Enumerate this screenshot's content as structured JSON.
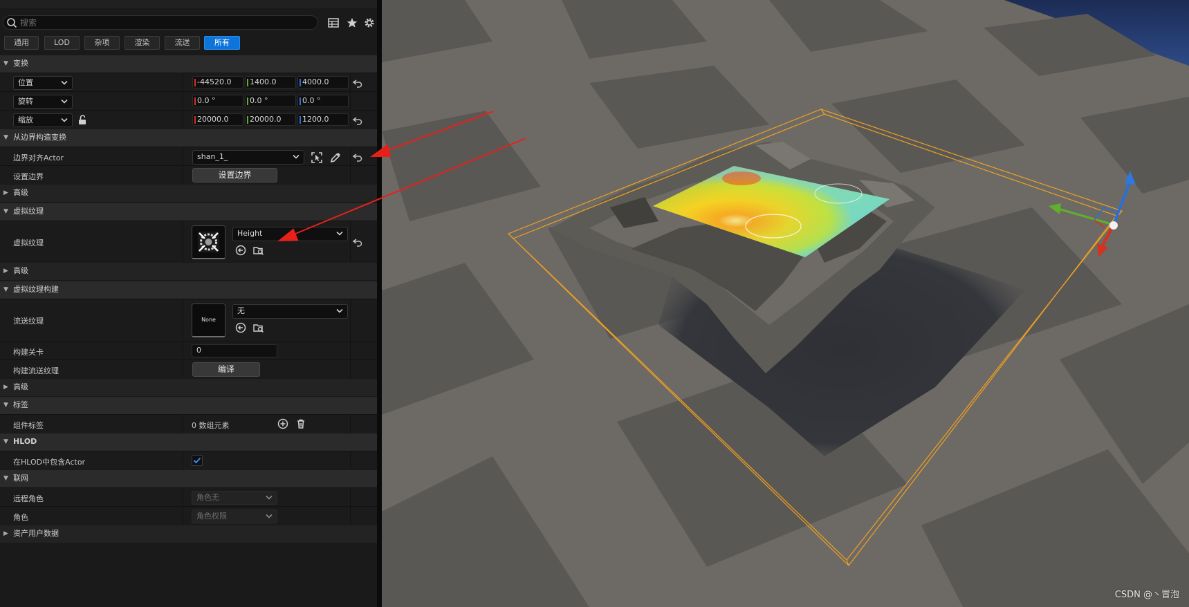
{
  "search": {
    "placeholder": "搜索"
  },
  "tabs": [
    {
      "label": "通用"
    },
    {
      "label": "LOD"
    },
    {
      "label": "杂项"
    },
    {
      "label": "渲染"
    },
    {
      "label": "流送"
    },
    {
      "label": "所有",
      "active": true
    }
  ],
  "transform": {
    "header": "变换",
    "location": {
      "label": "位置",
      "x": "-44520.0",
      "y": "1400.0",
      "z": "4000.0"
    },
    "rotation": {
      "label": "旋转",
      "x": "0.0 °",
      "y": "0.0 °",
      "z": "0.0 °"
    },
    "scale": {
      "label": "缩放",
      "x": "20000.0",
      "y": "20000.0",
      "z": "1200.0"
    }
  },
  "bounds_transform": {
    "header": "从边界构造变换",
    "align_actor": {
      "label": "边界对齐Actor",
      "value": "shan_1_"
    },
    "set_bounds": {
      "label": "设置边界",
      "button": "设置边界"
    }
  },
  "advanced_1": {
    "header": "高级"
  },
  "virtual_texture": {
    "header": "虚拟纹理",
    "row_label": "虚拟纹理",
    "value": "Height"
  },
  "advanced_2": {
    "header": "高级"
  },
  "vt_build": {
    "header": "虚拟纹理构建",
    "streaming_texture": {
      "label": "流送纹理",
      "thumb_text": "None",
      "value": "无"
    },
    "build_level": {
      "label": "构建关卡",
      "value": "0"
    },
    "build_streaming": {
      "label": "构建流送纹理",
      "button": "编译"
    }
  },
  "advanced_3": {
    "header": "高级"
  },
  "tags": {
    "header": "标签",
    "component_tags": {
      "label": "组件标签",
      "value": "0 数组元素"
    }
  },
  "hlod": {
    "header": "HLOD",
    "include": {
      "label": "在HLOD中包含Actor",
      "checked": true
    }
  },
  "network": {
    "header": "联网",
    "remote_role": {
      "label": "远程角色",
      "value": "角色无"
    },
    "role": {
      "label": "角色",
      "value": "角色权限"
    }
  },
  "asset_user_data": {
    "header": "资产用户数据"
  },
  "watermark": "CSDN @丶冒泡",
  "colors": {
    "accent": "#0d74d9",
    "bounds_box": "#f0a020",
    "annotation_arrow": "#e8201a",
    "axis_x": "#d3331f",
    "axis_y": "#5fb02a",
    "axis_z": "#2b6fd6"
  }
}
